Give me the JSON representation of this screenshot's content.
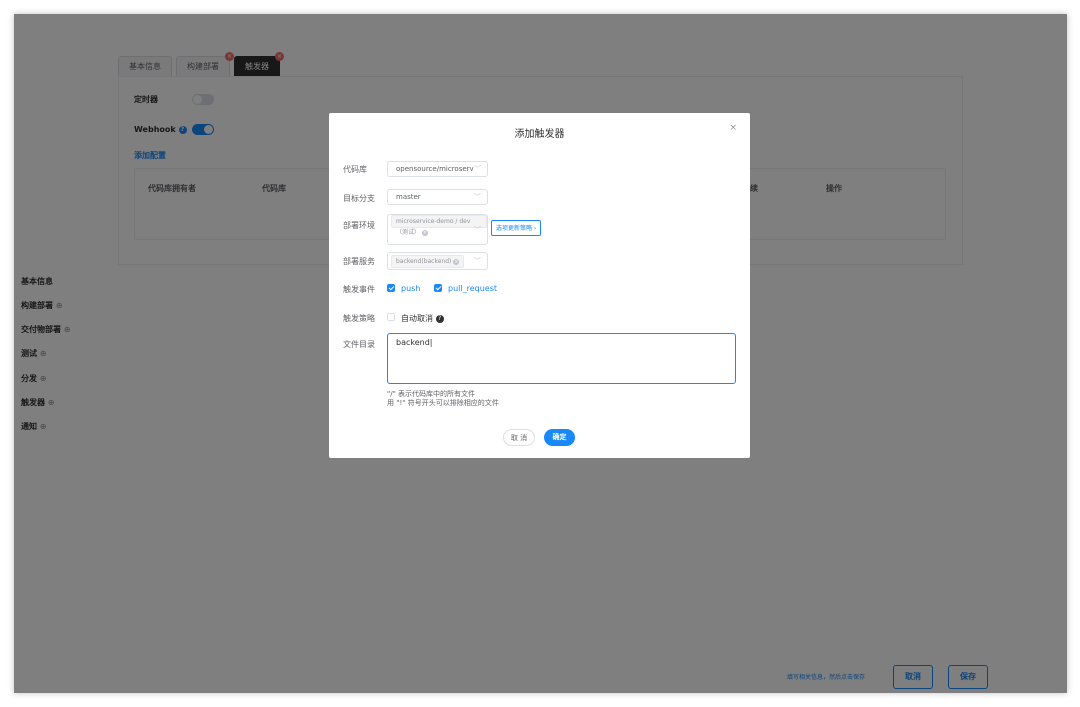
{
  "tabs": [
    {
      "label": "基本信息"
    },
    {
      "label": "构建部署",
      "badge": "×"
    },
    {
      "label": "触发器",
      "badge": "×"
    }
  ],
  "panel": {
    "timer_label": "定时器",
    "webhook_label": "Webhook",
    "add_config_link": "添加配置",
    "table_headers": {
      "owner": "代码库拥有者",
      "repo": "代码库",
      "partial": "续",
      "action": "操作"
    }
  },
  "sidebar": {
    "items": [
      {
        "label": "基本信息",
        "plus": ""
      },
      {
        "label": "构建部署",
        "plus": "⊕"
      },
      {
        "label": "交付物部署",
        "plus": "⊕"
      },
      {
        "label": "测试",
        "plus": "⊕"
      },
      {
        "label": "分发",
        "plus": "⊕"
      },
      {
        "label": "触发器",
        "plus": "⊕"
      },
      {
        "label": "通知",
        "plus": "⊕"
      }
    ]
  },
  "footer": {
    "hint": "填写相关信息，然后点击保存",
    "cancel": "取消",
    "save": "保存"
  },
  "dialog": {
    "title": "添加触发器",
    "close": "×",
    "fields": {
      "repo_label": "代码库",
      "repo_value": "opensource/microserv",
      "branch_label": "目标分支",
      "branch_value": "master",
      "env_label": "部署环境",
      "env_tag": "microservice-demo / dev（测试）",
      "env_strategy": "选项更新策略",
      "service_label": "部署服务",
      "service_tag": "backend(backend)",
      "event_label": "触发事件",
      "event_push": "push",
      "event_pr": "pull_request",
      "strategy_label": "触发策略",
      "auto_cancel": "自动取消",
      "dir_label": "文件目录",
      "dir_value": "backend"
    },
    "hint_line1": "\"/\" 表示代码库中的所有文件",
    "hint_line2": "用 \"!\" 符号开头可以排除相应的文件",
    "cancel": "取 消",
    "ok": "确定"
  }
}
